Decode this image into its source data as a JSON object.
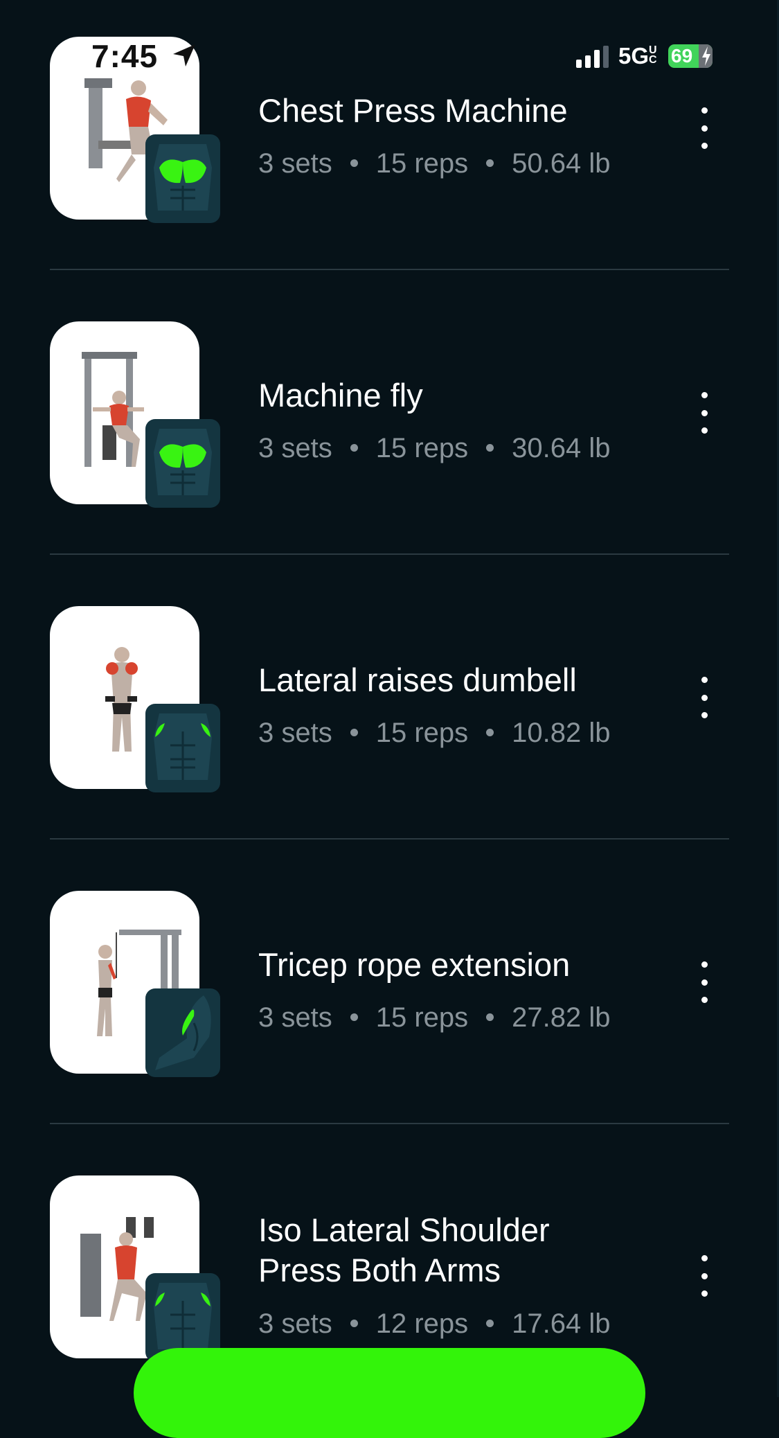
{
  "status_bar": {
    "time": "7:45",
    "network": "5G",
    "network_suffix": "UC",
    "battery": "69"
  },
  "exercises": [
    {
      "name": "Chest Press Machine",
      "sets": "3 sets",
      "reps": "15 reps",
      "weight": "50.64 lb",
      "muscle": "chest"
    },
    {
      "name": "Machine fly",
      "sets": "3 sets",
      "reps": "15 reps",
      "weight": "30.64 lb",
      "muscle": "chest"
    },
    {
      "name": "Lateral raises dumbell",
      "sets": "3 sets",
      "reps": "15 reps",
      "weight": "10.82 lb",
      "muscle": "shoulders"
    },
    {
      "name": "Tricep rope extension",
      "sets": "3 sets",
      "reps": "15 reps",
      "weight": "27.82 lb",
      "muscle": "triceps"
    },
    {
      "name": "Iso Lateral Shoulder Press Both Arms",
      "name_line1": "Iso Lateral Shoulder",
      "name_line2": "Press Both Arms",
      "sets": "3 sets",
      "reps": "12 reps",
      "weight": "17.64 lb",
      "muscle": "shoulders"
    }
  ],
  "colors": {
    "background": "#061218",
    "accent": "#33f40a",
    "muscle_highlight": "#39f312",
    "muscle_tile": "#143540"
  }
}
